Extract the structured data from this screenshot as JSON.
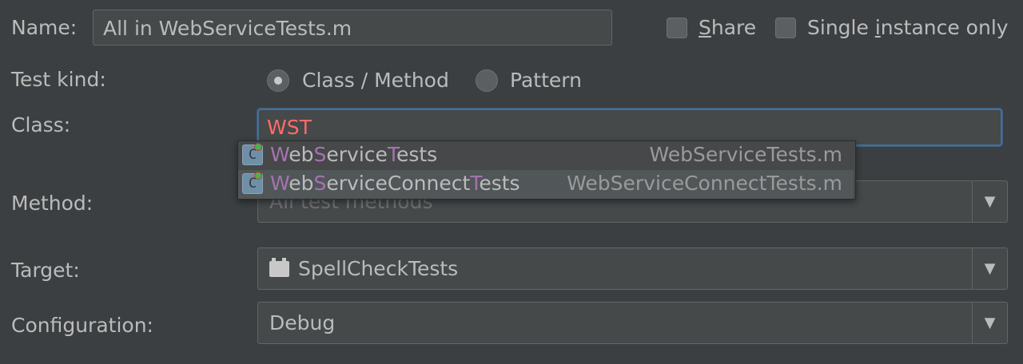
{
  "form": {
    "name_label": "Name:",
    "name_value": "All in WebServiceTests.m",
    "share_label": "Share",
    "single_label": "Single instance only",
    "test_kind_label": "Test kind:",
    "radio_class": "Class / Method",
    "radio_pattern": "Pattern",
    "selected_test_kind": "Class / Method",
    "class_label": "Class:",
    "class_value": "WST",
    "method_label": "Method:",
    "method_placeholder": "All test methods",
    "target_label": "Target:",
    "target_value": "SpellCheckTests",
    "configuration_label": "Configuration:",
    "configuration_value": "Debug",
    "share_checked": false,
    "single_checked": false
  },
  "completion": {
    "items": [
      {
        "icon": "class-icon",
        "icon_letter": "C",
        "name_parts": [
          "W",
          "eb",
          "S",
          "ervice",
          "T",
          "ests"
        ],
        "file": "WebServiceTests.m",
        "selected": false
      },
      {
        "icon": "class-icon",
        "icon_letter": "C",
        "name_parts": [
          "W",
          "eb",
          "S",
          "erviceConnect",
          "T",
          "ests"
        ],
        "file": "WebServiceConnectTests.m",
        "selected": true
      }
    ]
  },
  "icons": {
    "dropdown": "▼",
    "target": "folder-icon"
  },
  "colors": {
    "background": "#3c3f41",
    "match_highlight": "#a573b0",
    "class_input_text": "#ff6b68",
    "focus_border": "#466d94"
  }
}
